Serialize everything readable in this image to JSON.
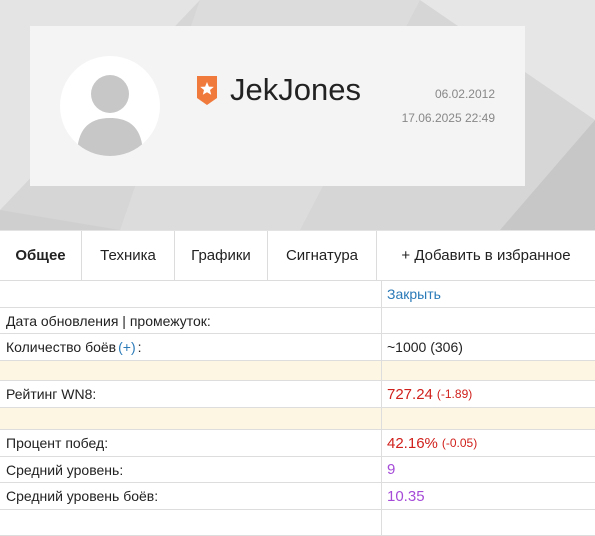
{
  "profile": {
    "username": "JekJones",
    "registered_date": "06.02.2012",
    "last_battle": "17.06.2025 22:49"
  },
  "tabs": [
    {
      "label": "Общее",
      "active": true
    },
    {
      "label": "Техника",
      "active": false
    },
    {
      "label": "Графики",
      "active": false
    },
    {
      "label": "Сигнатура",
      "active": false
    },
    {
      "label": "+ Добавить в избранное",
      "active": false
    }
  ],
  "table": {
    "close_link": "Закрыть",
    "rows": {
      "update": {
        "label": "Дата обновления | промежуток:",
        "value": ""
      },
      "battles": {
        "label_before": "Количество боёв",
        "label_plus": "(+)",
        "label_after": ":",
        "value": "~1000 (306)"
      },
      "wn8": {
        "label": "Рейтинг WN8:",
        "value": "727.24",
        "delta": "(-1.89)"
      },
      "winrate": {
        "label": "Процент побед:",
        "value": "42.16%",
        "delta": "(-0.05)"
      },
      "avg_tier": {
        "label": "Средний уровень:",
        "value": "9"
      },
      "avg_tier_battles": {
        "label": "Средний уровень боёв:",
        "value": "10.35"
      }
    }
  },
  "colors": {
    "link": "#2a7ab8",
    "negative": "#d0201c",
    "purple": "#a54bd8",
    "badge": "#f07a3c",
    "spacer": "#fdf6e3"
  }
}
